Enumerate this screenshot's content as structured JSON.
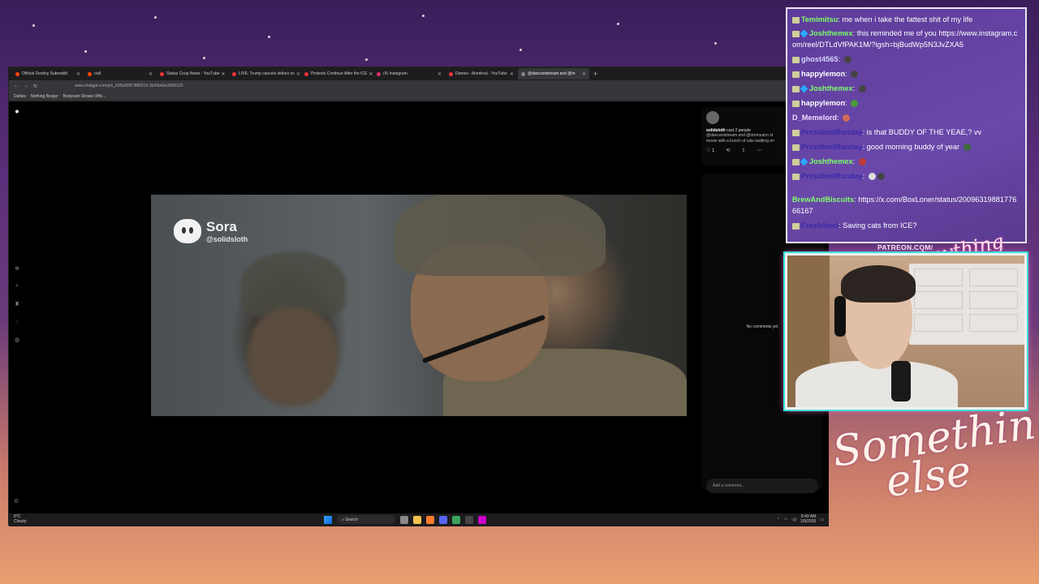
{
  "browser": {
    "tabs": [
      {
        "label": "Official Destiny Subreddit",
        "favicon_color": "#ff4500"
      },
      {
        "label": "r/all",
        "favicon_color": "#ff4500"
      },
      {
        "label": "Status Coup News - YouTube",
        "favicon_color": "#ff0000"
      },
      {
        "label": "LIVE: Trump cancels strikes on",
        "favicon_color": "#ff0000"
      },
      {
        "label": "Protests Continue After the ICE",
        "favicon_color": "#ff0000"
      },
      {
        "label": "(4) Instagram",
        "favicon_color": "#e1306c"
      },
      {
        "label": "Dames - Montreal - YouTube",
        "favicon_color": "#ff0000"
      },
      {
        "label": "@dancantstream and @m",
        "favicon_color": "#888888"
      }
    ],
    "url": "www.chatgpt.com/p/s_695d45f57f8f5919 0b26b6be3009120",
    "bookmarks": [
      "Dailies",
      "Nothing Burger",
      "Bodycam Shows Offic..."
    ]
  },
  "video": {
    "brand": "Sora",
    "handle": "@solidsloth"
  },
  "side_panel": {
    "username": "solidsloth",
    "action": "cast 2 people",
    "description_1": "@dancantstream and @mrmouton st",
    "description_2": "movie with a bunch of cats walking on",
    "likes": "1",
    "no_comments": "No comments yet",
    "add_comment_placeholder": "Add a comment..."
  },
  "taskbar": {
    "temp": "8°C",
    "weather": "Cloudy",
    "search": "Search",
    "time": "8:43 AM",
    "date": "1/9/2026"
  },
  "chat": {
    "messages": [
      {
        "user": "Temimitsu",
        "color": "#7dff6a",
        "badges": [
          "sub"
        ],
        "text": "me when i take the fattest shit of my life"
      },
      {
        "user": "Joshthemex",
        "color": "#7dff6a",
        "badges": [
          "sub",
          "gem"
        ],
        "text": "this reminded me of you https://www.instagram.com/reel/DTLdVfPAK1M/?igsh=bjBudWp5N3JvZXA5"
      },
      {
        "user": "ghost4565",
        "color": "#d7d7ff",
        "badges": [
          "sub"
        ],
        "text": ""
      },
      {
        "user": "happylemon",
        "color": "#ffffff",
        "badges": [
          "sub"
        ],
        "text": ""
      },
      {
        "user": "Joshthemex",
        "color": "#7dff6a",
        "badges": [
          "sub",
          "gem"
        ],
        "text": ""
      },
      {
        "user": "happylemon",
        "color": "#ffffff",
        "badges": [
          "sub"
        ],
        "text": ""
      },
      {
        "user": "D_Memelord",
        "color": "#f0d8ff",
        "badges": [],
        "text": ""
      },
      {
        "user": "PresidentRunday",
        "color": "#3a2aa8",
        "badges": [
          "sub"
        ],
        "text": "is that BUDDY OF THE YEAE,? vv"
      },
      {
        "user": "PresidentRunday",
        "color": "#3a2aa8",
        "badges": [
          "sub"
        ],
        "text": "good morning buddy of year"
      },
      {
        "user": "Joshthemex",
        "color": "#7dff6a",
        "badges": [
          "sub",
          "gem"
        ],
        "text": ""
      },
      {
        "user": "PresidentRunday",
        "color": "#3a2aa8",
        "badges": [
          "sub"
        ],
        "text": ""
      },
      {
        "user": "BrewAndBiscuits",
        "color": "#7dff6a",
        "badges": [],
        "text": "https://x.com/BoxLoner/status/2009631988177666167"
      },
      {
        "user": "Fresh4mel",
        "color": "#3a2aa8",
        "badges": [
          "sub"
        ],
        "text": "Saving cats from ICE?"
      }
    ]
  },
  "overlay": {
    "patreon": "PATREON.COM/",
    "anything": "Anything else?",
    "something_1": "Something",
    "something_2": "else"
  }
}
